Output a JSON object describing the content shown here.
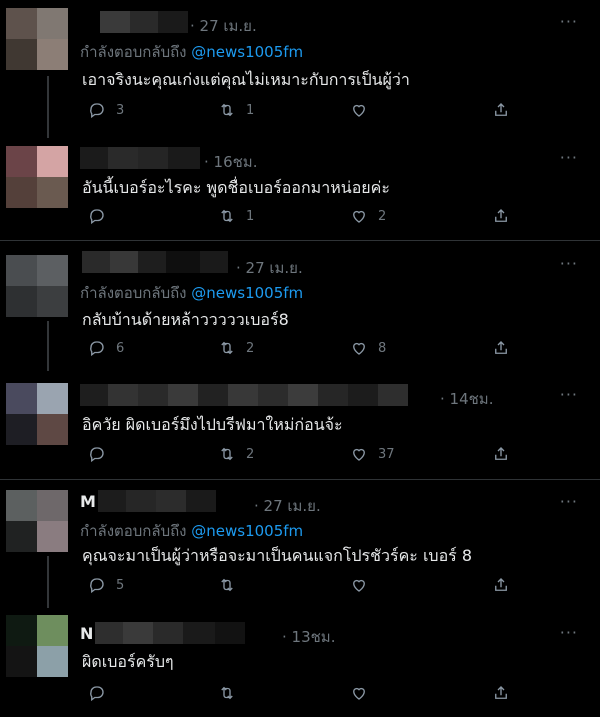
{
  "threads": [
    {
      "parent": {
        "time": "· 27 เม.ย.",
        "reply_prefix": "กำลังตอบกลับถึง",
        "reply_handle": "@news1005fm",
        "text": "เอาจริงนะคุณเก่งแต่คุณไม่เหมาะกับการเป็นผู้ว่า",
        "replies": "3",
        "retweets": "1",
        "likes": ""
      },
      "child": {
        "time": "· 16ชม.",
        "text": "อันนี้เบอร์อะไรคะ พูดชื่อเบอร์ออกมาหน่อยค่ะ",
        "replies": "",
        "retweets": "1",
        "likes": "2"
      }
    },
    {
      "parent": {
        "time": "· 27 เม.ย.",
        "reply_prefix": "กำลังตอบกลับถึง",
        "reply_handle": "@news1005fm",
        "text": "กลับบ้านด้ายหล้าวววววเบอร์8",
        "replies": "6",
        "retweets": "2",
        "likes": "8"
      },
      "child": {
        "time": "· 14ชม.",
        "text": "อิควัย ผิดเบอร์มึงไปบรีฟมาใหม่ก่อนจ้ะ",
        "replies": "",
        "retweets": "2",
        "likes": "37"
      }
    },
    {
      "parent": {
        "name_initial": "M",
        "time": "· 27 เม.ย.",
        "reply_prefix": "กำลังตอบกลับถึง",
        "reply_handle": "@news1005fm",
        "text": "คุณจะมาเป็นผู้ว่าหรือจะมาเป็นคนแจกโปรชัวร์คะ เบอร์ 8",
        "replies": "5",
        "retweets": "",
        "likes": ""
      },
      "child": {
        "name_initial": "N",
        "time": "· 13ชม.",
        "text": "ผิดเบอร์ครับๆ",
        "replies": "",
        "retweets": "",
        "likes": ""
      }
    }
  ],
  "more_label": "···",
  "colors": {
    "background": "#000000",
    "link": "#1d9bf0",
    "muted": "#6e767d",
    "text": "#e7e9ea",
    "separator": "#2f3336"
  }
}
